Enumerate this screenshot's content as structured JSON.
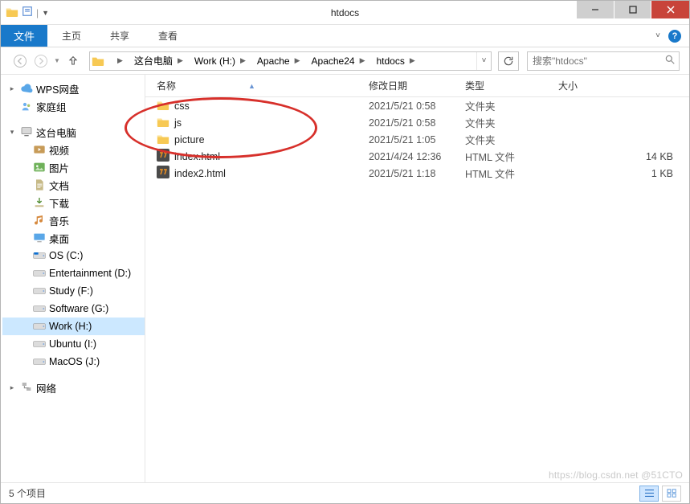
{
  "window": {
    "title": "htdocs"
  },
  "ribbon": {
    "file": "文件",
    "tabs": [
      "主页",
      "共享",
      "查看"
    ]
  },
  "nav": {
    "crumbs": [
      "这台电脑",
      "Work (H:)",
      "Apache",
      "Apache24",
      "htdocs"
    ],
    "search_placeholder": "搜索\"htdocs\""
  },
  "tree": {
    "items": [
      {
        "type": "node",
        "icon": "cloud",
        "label": "WPS网盘",
        "exp": "▸",
        "indent": 0
      },
      {
        "type": "node",
        "icon": "home",
        "label": "家庭组",
        "exp": "",
        "indent": 0
      },
      {
        "type": "gap"
      },
      {
        "type": "node",
        "icon": "computer",
        "label": "这台电脑",
        "exp": "▾",
        "indent": 0
      },
      {
        "type": "node",
        "icon": "video",
        "label": "视频",
        "exp": "",
        "indent": 1
      },
      {
        "type": "node",
        "icon": "picture",
        "label": "图片",
        "exp": "",
        "indent": 1
      },
      {
        "type": "node",
        "icon": "doc",
        "label": "文档",
        "exp": "",
        "indent": 1
      },
      {
        "type": "node",
        "icon": "download",
        "label": "下载",
        "exp": "",
        "indent": 1
      },
      {
        "type": "node",
        "icon": "music",
        "label": "音乐",
        "exp": "",
        "indent": 1
      },
      {
        "type": "node",
        "icon": "desktop",
        "label": "桌面",
        "exp": "",
        "indent": 1
      },
      {
        "type": "node",
        "icon": "drive-os",
        "label": "OS (C:)",
        "exp": "",
        "indent": 1
      },
      {
        "type": "node",
        "icon": "drive",
        "label": "Entertainment (D:)",
        "exp": "",
        "indent": 1
      },
      {
        "type": "node",
        "icon": "drive",
        "label": "Study (F:)",
        "exp": "",
        "indent": 1
      },
      {
        "type": "node",
        "icon": "drive",
        "label": "Software (G:)",
        "exp": "",
        "indent": 1
      },
      {
        "type": "node",
        "icon": "drive",
        "label": "Work (H:)",
        "exp": "",
        "indent": 1,
        "selected": true
      },
      {
        "type": "node",
        "icon": "drive",
        "label": "Ubuntu (I:)",
        "exp": "",
        "indent": 1
      },
      {
        "type": "node",
        "icon": "drive",
        "label": "MacOS (J:)",
        "exp": "",
        "indent": 1
      },
      {
        "type": "gap"
      },
      {
        "type": "node",
        "icon": "network",
        "label": "网络",
        "exp": "▸",
        "indent": 0
      }
    ]
  },
  "columns": {
    "name": "名称",
    "date": "修改日期",
    "type": "类型",
    "size": "大小"
  },
  "files": [
    {
      "icon": "folder",
      "name": "css",
      "date": "2021/5/21 0:58",
      "type": "文件夹",
      "size": ""
    },
    {
      "icon": "folder",
      "name": "js",
      "date": "2021/5/21 0:58",
      "type": "文件夹",
      "size": ""
    },
    {
      "icon": "folder",
      "name": "picture",
      "date": "2021/5/21 1:05",
      "type": "文件夹",
      "size": ""
    },
    {
      "icon": "html",
      "name": "index.html",
      "date": "2021/4/24 12:36",
      "type": "HTML 文件",
      "size": "14 KB"
    },
    {
      "icon": "html",
      "name": "index2.html",
      "date": "2021/5/21 1:18",
      "type": "HTML 文件",
      "size": "1 KB"
    }
  ],
  "status": {
    "count": "5 个项目"
  },
  "watermark": "https://blog.csdn.net  @51CTO"
}
